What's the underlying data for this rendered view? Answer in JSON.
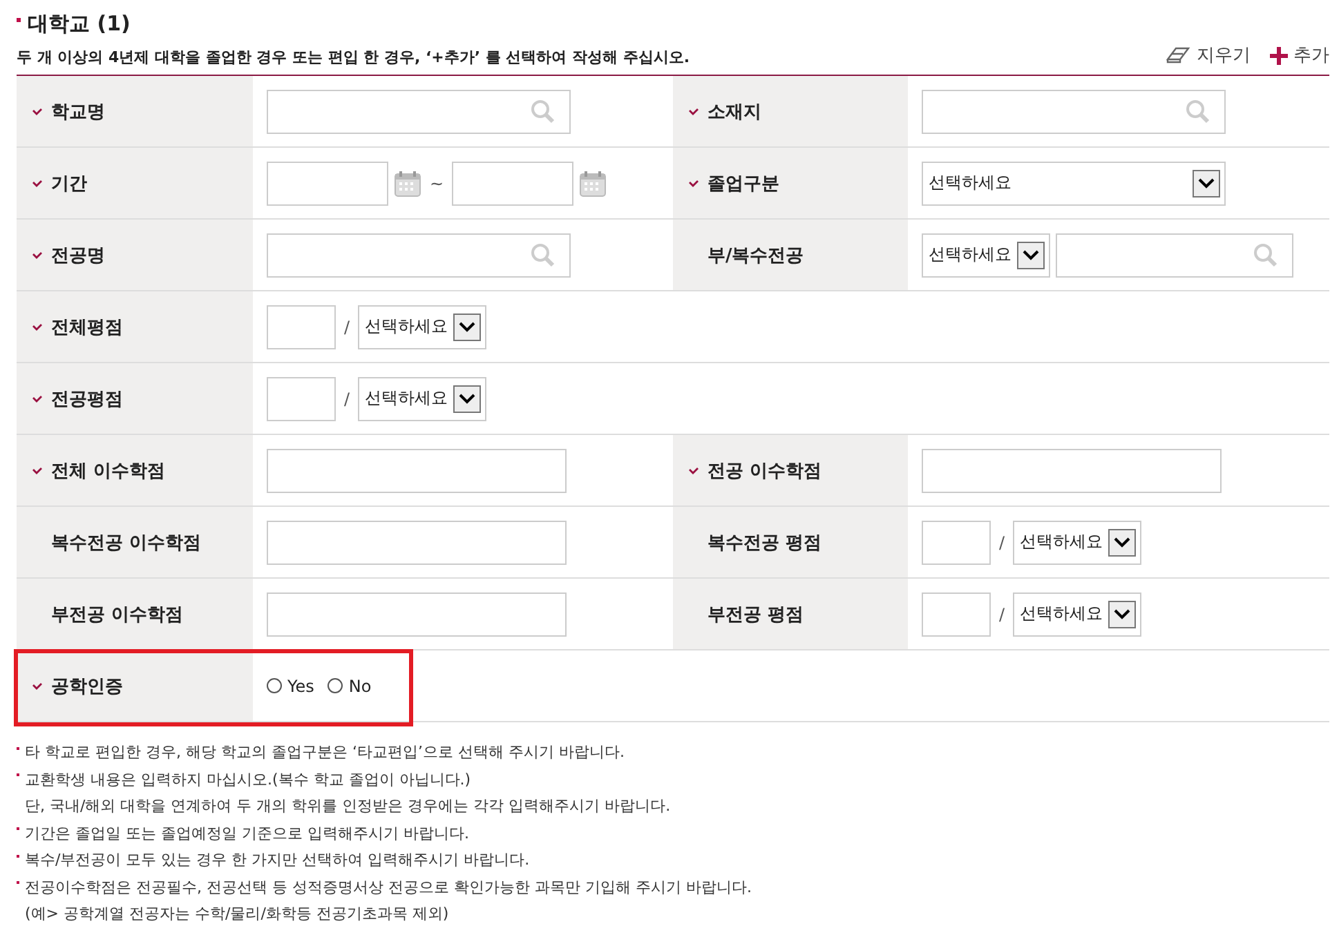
{
  "section": {
    "title": "대학교 (1)",
    "description": "두 개 이상의 4년제 대학을 졸업한 경우 또는 편입 한 경우, ‘+추가’ 를 선택하여 작성해 주십시오.",
    "actions": [
      {
        "kind": "clear",
        "label": "지우기"
      },
      {
        "kind": "add",
        "label": "추가"
      }
    ]
  },
  "rows": [
    {
      "cells": [
        {
          "label": "학교명",
          "required": true,
          "field": {
            "kind": "search"
          }
        },
        {
          "label": "소재지",
          "required": true,
          "field": {
            "kind": "search"
          }
        }
      ]
    },
    {
      "cells": [
        {
          "label": "기간",
          "required": true,
          "field": {
            "kind": "date_range",
            "separator": "~"
          }
        },
        {
          "label": "졸업구분",
          "required": true,
          "field": {
            "kind": "select",
            "placeholder": "선택하세요"
          }
        }
      ]
    },
    {
      "cells": [
        {
          "label": "전공명",
          "required": true,
          "field": {
            "kind": "search"
          }
        },
        {
          "label": "부/복수전공",
          "required": false,
          "field": {
            "kind": "select_search",
            "placeholder": "선택하세요"
          }
        }
      ]
    },
    {
      "cells": [
        {
          "label": "전체평점",
          "required": true,
          "field": {
            "kind": "score",
            "separator": "/",
            "placeholder": "선택하세요"
          }
        }
      ]
    },
    {
      "cells": [
        {
          "label": "전공평점",
          "required": true,
          "field": {
            "kind": "score",
            "separator": "/",
            "placeholder": "선택하세요"
          }
        }
      ]
    },
    {
      "cells": [
        {
          "label": "전체 이수학점",
          "required": true,
          "field": {
            "kind": "text"
          }
        },
        {
          "label": "전공 이수학점",
          "required": true,
          "field": {
            "kind": "text"
          }
        }
      ]
    },
    {
      "cells": [
        {
          "label": "복수전공 이수학점",
          "required": false,
          "field": {
            "kind": "text"
          }
        },
        {
          "label": "복수전공 평점",
          "required": false,
          "field": {
            "kind": "score",
            "separator": "/",
            "placeholder": "선택하세요"
          }
        }
      ]
    },
    {
      "cells": [
        {
          "label": "부전공 이수학점",
          "required": false,
          "field": {
            "kind": "text"
          }
        },
        {
          "label": "부전공 평점",
          "required": false,
          "field": {
            "kind": "score",
            "separator": "/",
            "placeholder": "선택하세요"
          }
        }
      ]
    },
    {
      "highlighted": true,
      "cells": [
        {
          "label": "공학인증",
          "required": true,
          "field": {
            "kind": "radio",
            "options": [
              {
                "label": "Yes",
                "selected": false
              },
              {
                "label": "No",
                "selected": false
              }
            ]
          }
        }
      ]
    }
  ],
  "notes": [
    {
      "lines": [
        "타 학교로 편입한 경우, 해당 학교의 졸업구분은 ‘타교편입’으로 선택해 주시기 바랍니다."
      ]
    },
    {
      "lines": [
        "교환학생 내용은 입력하지 마십시오.(복수 학교 졸업이 아닙니다.)",
        "단, 국내/해외 대학을 연계하여 두 개의 학위를 인정받은 경우에는 각각 입력해주시기 바랍니다."
      ]
    },
    {
      "lines": [
        "기간은 졸업일 또는 졸업예정일 기준으로 입력해주시기 바랍니다."
      ]
    },
    {
      "lines": [
        "복수/부전공이 모두 있는 경우 한 가지만 선택하여 입력해주시기 바랍니다."
      ]
    },
    {
      "lines": [
        "전공이수학점은 전공필수, 전공선택 등 성적증명서상 전공으로 확인가능한 과목만 기입해 주시기 바랍니다.",
        "(예> 공학계열 전공자는 수학/물리/화학등 전공기초과목 제외)"
      ]
    }
  ]
}
